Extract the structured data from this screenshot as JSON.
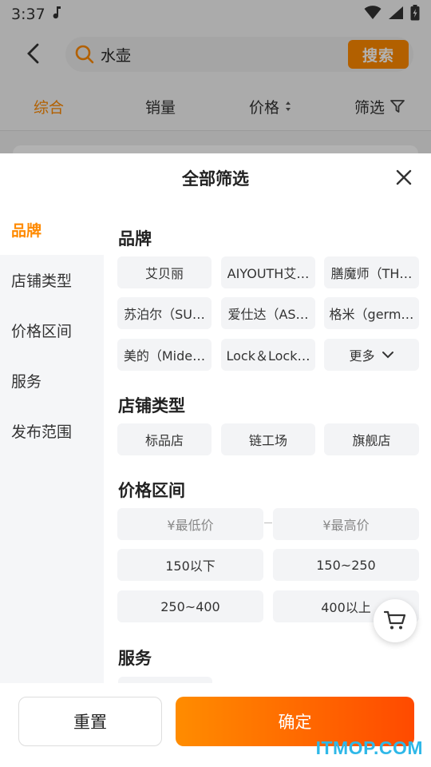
{
  "status_bar": {
    "time": "3:37"
  },
  "header": {
    "search_value": "水壶",
    "search_button": "搜索"
  },
  "sort_tabs": [
    {
      "label": "综合",
      "active": true
    },
    {
      "label": "销量",
      "active": false
    },
    {
      "label": "价格",
      "active": false
    },
    {
      "label": "筛选",
      "active": false
    }
  ],
  "panel": {
    "title": "全部筛选",
    "categories": [
      {
        "label": "品牌",
        "active": true
      },
      {
        "label": "店铺类型",
        "active": false
      },
      {
        "label": "价格区间",
        "active": false
      },
      {
        "label": "服务",
        "active": false
      },
      {
        "label": "发布范围",
        "active": false
      }
    ],
    "brand": {
      "title": "品牌",
      "options": [
        "艾贝丽",
        "AIYOUTH艾…",
        "膳魔师（TH…",
        "苏泊尔（SU…",
        "爱仕达（AS…",
        "格米（germ…",
        "美的（Mide…",
        "Lock＆Lock…"
      ],
      "more_label": "更多"
    },
    "store_type": {
      "title": "店铺类型",
      "options": [
        "标品店",
        "链工场",
        "旗舰店"
      ]
    },
    "price_range": {
      "title": "价格区间",
      "min_placeholder": "¥最低价",
      "max_placeholder": "¥最高价",
      "options": [
        "150以下",
        "150~250",
        "250~400",
        "400以上"
      ]
    },
    "service": {
      "title": "服务"
    }
  },
  "footer": {
    "reset_label": "重置",
    "confirm_label": "确定"
  },
  "watermark": "ITMOP.COM",
  "colors": {
    "accent": "#ff8a00",
    "confirm_end": "#ff4a00",
    "watermark": "#2fb8e8"
  }
}
